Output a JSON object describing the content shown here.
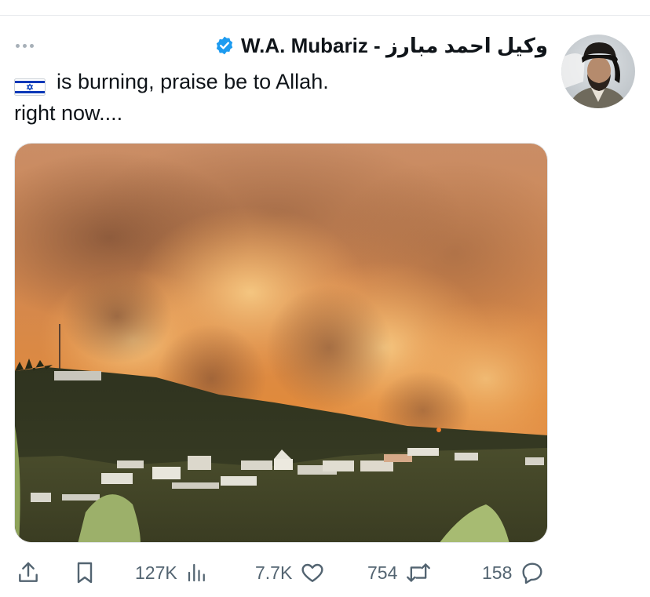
{
  "tweet": {
    "display_name": "وکیل احمد مبارز - W.A. Mubariz",
    "verified_icon": "verified-badge-icon",
    "more_icon": "more-options-icon",
    "avatar": "user-avatar",
    "text_line1": "is burning, praise be to Allah.",
    "text_line2": "right now....",
    "flag_icon": "israel-flag-icon",
    "media": "wildfire-photo"
  },
  "actions": {
    "views": "127K",
    "likes": "7.7K",
    "reposts": "754",
    "replies": "158"
  },
  "colors": {
    "verified": "#1d9bf0",
    "icon_gray": "#536471",
    "text": "#0f1419",
    "flag_blue": "#0038b8"
  }
}
